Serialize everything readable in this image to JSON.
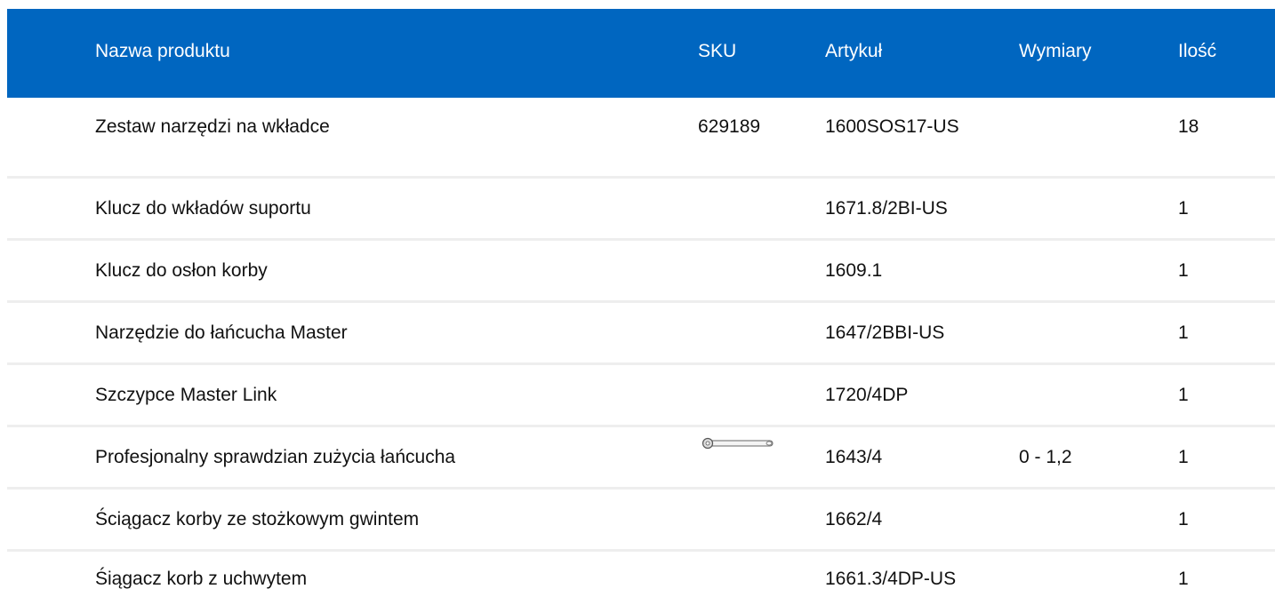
{
  "header": {
    "name": "Nazwa produktu",
    "sku": "SKU",
    "article": "Artykuł",
    "dimensions": "Wymiary",
    "quantity": "Ilość"
  },
  "colors": {
    "header_bg": "#0066c0",
    "header_text": "#ffffff",
    "divider": "#eeeeee",
    "row_text": "#111111"
  },
  "rows": [
    {
      "name": "Zestaw narzędzi na wkładce",
      "sku": "629189",
      "article": "1600SOS17-US",
      "dimensions": "",
      "quantity": "18"
    },
    {
      "name": "Klucz do wkładów suportu",
      "sku": "",
      "article": "1671.8/2BI-US",
      "dimensions": "",
      "quantity": "1"
    },
    {
      "name": "Klucz do osłon korby",
      "sku": "",
      "article": "1609.1",
      "dimensions": "",
      "quantity": "1"
    },
    {
      "name": "Narzędzie do łańcucha Master",
      "sku": "",
      "article": "1647/2BBI-US",
      "dimensions": "",
      "quantity": "1"
    },
    {
      "name": "Szczypce Master Link",
      "sku": "",
      "article": "1720/4DP",
      "dimensions": "",
      "quantity": "1"
    },
    {
      "name": "Profesjonalny sprawdzian zużycia łańcucha",
      "sku": "",
      "article": "1643/4",
      "dimensions": "0 - 1,2",
      "quantity": "1",
      "thumbnail_icon": "chain-wear-gauge-icon"
    },
    {
      "name": "Ściągacz korby ze stożkowym gwintem",
      "sku": "",
      "article": "1662/4",
      "dimensions": "",
      "quantity": "1"
    },
    {
      "name": "Śiągacz korb z uchwytem",
      "sku": "",
      "article": "1661.3/4DP-US",
      "dimensions": "",
      "quantity": "1"
    }
  ]
}
